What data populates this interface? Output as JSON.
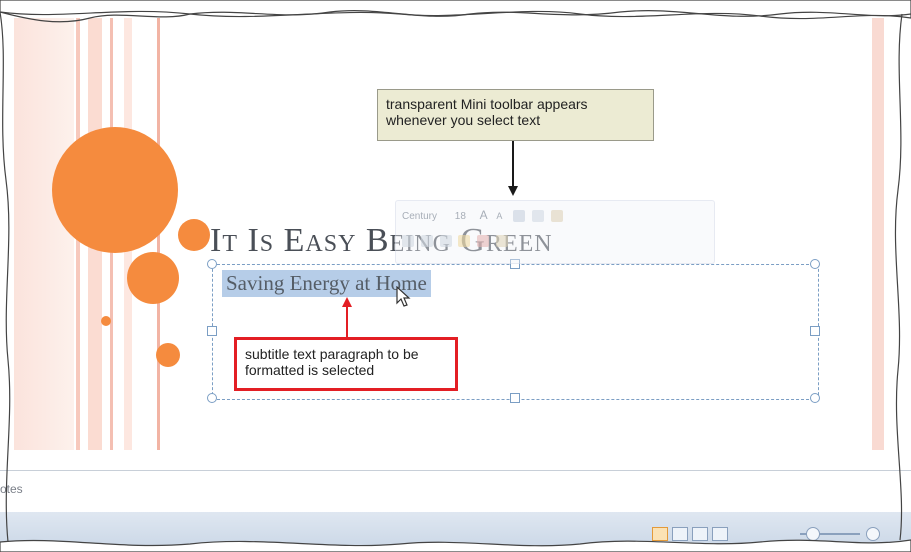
{
  "slide": {
    "title": "It Is Easy Being Green",
    "subtitle": "Saving Energy at Home"
  },
  "mini_toolbar": {
    "font_name": "Century",
    "font_size": "18",
    "grow_font": "A",
    "shrink_font": "A"
  },
  "callouts": {
    "mini_toolbar_note": "transparent Mini toolbar appears whenever you select text",
    "subtitle_note": "subtitle text paragraph to be formatted is selected"
  },
  "notes_pane": {
    "label": "otes"
  },
  "colors": {
    "accent_orange": "#f58b3e",
    "selection_blue": "#b6cde8",
    "callout_red": "#e31e24",
    "callout_beige": "#ecebd3"
  },
  "icons": [
    "mouse-pointer-icon",
    "grow-font-icon",
    "shrink-font-icon",
    "bullets-icon",
    "indent-icon",
    "format-painter-icon",
    "normal-view-icon",
    "zoom-slider-icon"
  ]
}
